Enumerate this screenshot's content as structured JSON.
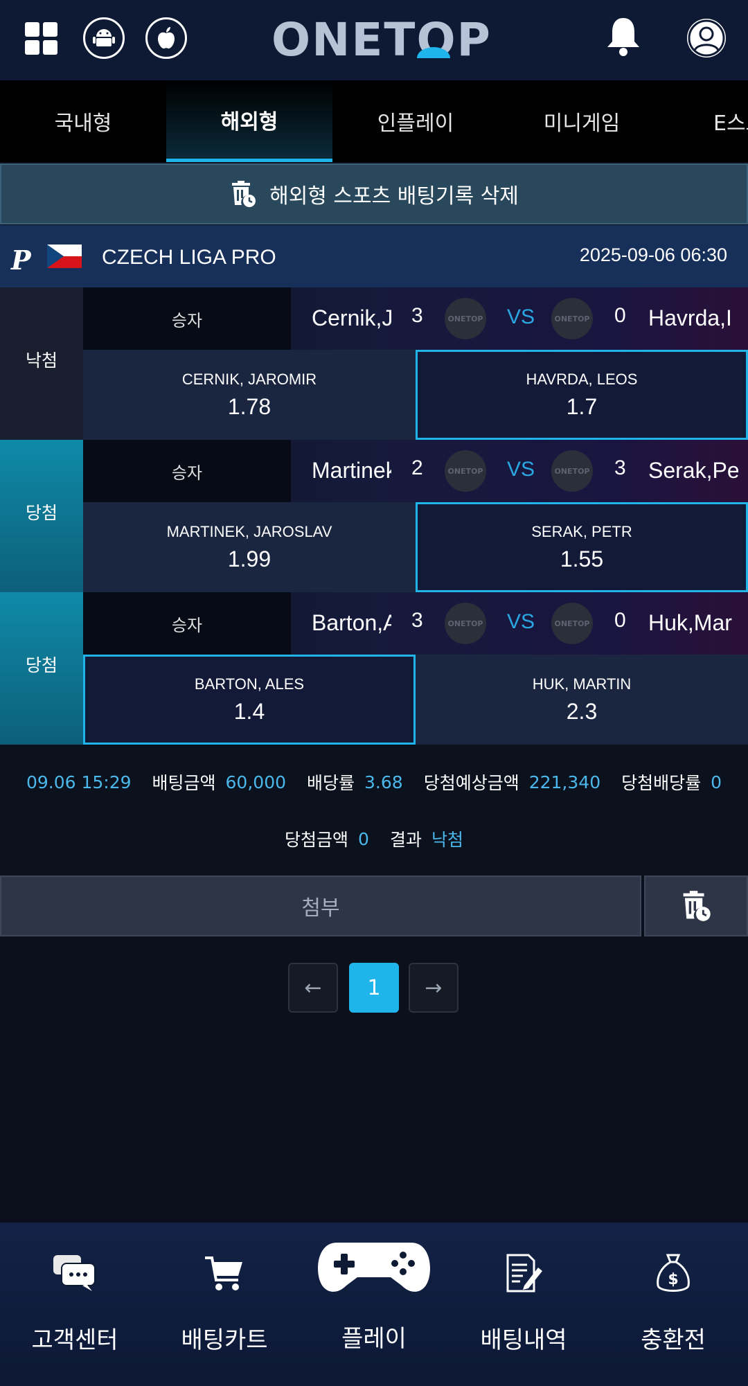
{
  "header": {
    "logo_text": "ONETOP",
    "icons": [
      "grid-icon",
      "android-icon",
      "apple-icon",
      "bell-icon",
      "user-icon"
    ]
  },
  "tabs": [
    {
      "label": "국내형",
      "active": false
    },
    {
      "label": "해외형",
      "active": true
    },
    {
      "label": "인플레이",
      "active": false
    },
    {
      "label": "미니게임",
      "active": false
    },
    {
      "label": "E스포",
      "active": false
    }
  ],
  "delete_banner": {
    "label": "해외형 스포츠 배팅기록 삭제"
  },
  "league": {
    "name": "CZECH LIGA PRO",
    "datetime": "2025-09-06 06:30",
    "provider_letter": "P"
  },
  "bets": [
    {
      "status": "낙첨",
      "type": "승자",
      "home_short": "Cernik,J",
      "home_score": "3",
      "vs": "VS",
      "away_score": "0",
      "away_short": "Havrda,I",
      "home_name": "CERNIK, JAROMIR",
      "home_odd": "1.78",
      "away_name": "HAVRDA, LEOS",
      "away_odd": "1.7",
      "selected": "away"
    },
    {
      "status": "당첨",
      "type": "승자",
      "home_short": "Martinek",
      "home_score": "2",
      "vs": "VS",
      "away_score": "3",
      "away_short": "Serak,Pe",
      "home_name": "MARTINEK, JAROSLAV",
      "home_odd": "1.99",
      "away_name": "SERAK, PETR",
      "away_odd": "1.55",
      "selected": "away"
    },
    {
      "status": "당첨",
      "type": "승자",
      "home_short": "Barton,A",
      "home_score": "3",
      "vs": "VS",
      "away_score": "0",
      "away_short": "Huk,Mar",
      "home_name": "BARTON, ALES",
      "home_odd": "1.4",
      "away_name": "HUK, MARTIN",
      "away_odd": "2.3",
      "selected": "home"
    }
  ],
  "summary": {
    "time": "09.06 15:29",
    "bet_amount_label": "배팅금액",
    "bet_amount": "60,000",
    "odds_label": "배당률",
    "odds": "3.68",
    "expected_label": "당첨예상금액",
    "expected": "221,340",
    "win_odds_label": "당첨배당률",
    "win_odds": "0",
    "win_amount_label": "당첨금액",
    "win_amount": "0",
    "result_label": "결과",
    "result": "낙첨"
  },
  "attach": {
    "label": "첨부"
  },
  "pagination": {
    "prev": "←",
    "current": "1",
    "next": "→"
  },
  "bottom_nav": [
    {
      "label": "고객센터",
      "icon": "chat-icon"
    },
    {
      "label": "배팅카트",
      "icon": "cart-icon"
    },
    {
      "label": "플레이",
      "icon": "gamepad-icon"
    },
    {
      "label": "배팅내역",
      "icon": "document-edit-icon"
    },
    {
      "label": "충환전",
      "icon": "money-bag-icon"
    }
  ],
  "colors": {
    "accent": "#1fb5ea",
    "header_bg": "#0e1a33",
    "win_bg": "#0e8aa8"
  }
}
